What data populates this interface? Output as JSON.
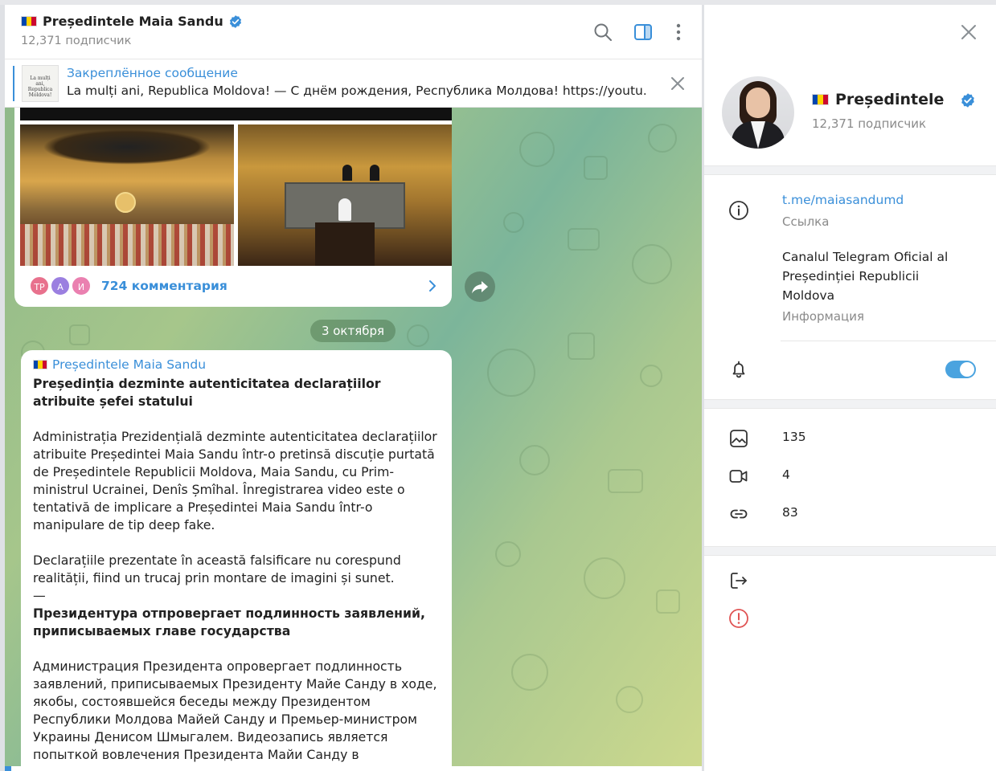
{
  "header": {
    "channel_name": "Președintele Maia Sandu",
    "subscribers": "12,371 подписчик",
    "icons": [
      "search-icon",
      "sidebar-toggle-icon",
      "more-vert-icon"
    ]
  },
  "pinned": {
    "title": "Закреплённое сообщение",
    "text": "La mulți ani, Republica Moldova! — С днём рождения, Республика Молдова!  https://youtu.b...",
    "thumb_text": "La mulți ani, Republica Moldova!"
  },
  "message1": {
    "avatars": [
      {
        "initials": "ТР",
        "color": "#e8718d"
      },
      {
        "initials": "А",
        "color": "#9b7fe0"
      },
      {
        "initials": "И",
        "color": "#ea80b0"
      }
    ],
    "comments": "724 комментария"
  },
  "date_separator": "3 октября",
  "message2": {
    "author": "Președintele Maia Sandu",
    "title_ro": "Președinția dezminte autenticitatea declarațiilor atribuite șefei statului",
    "para1_ro": "Administrația Prezidențială dezminte autenticitatea declarațiilor atribuite Președintei Maia Sandu într-o pretinsă discuție purtată de Președintele Republicii Moldova, Maia Sandu, cu Prim-ministrul Ucrainei, Denîs Șmîhal. Înregistrarea video este o tentativă de implicare a Președintei Maia Sandu într-o manipulare de tip deep fake.",
    "para2_ro": "Declarațiile prezentate în această falsificare nu corespund realității, fiind un trucaj prin montare de imagini și sunet.",
    "divider": "—",
    "title_ru": "Президентура отпровергает подлинность заявлений, приписываемых главе государства",
    "para1_ru": "Администрация Президента опровергает подлинность заявлений, приписываемых Президенту Майе Санду в ходе, якобы, состоявшейся беседы между Президентом Республики Молдова Майей Санду и Премьер-министром Украины Денисом Шмыгалем. Видеозапись является попыткой вовлечения Президента Майи Санду в манипуляцию типа deep"
  },
  "panel": {
    "name": "Președintele",
    "subscribers": "12,371 подписчик",
    "link": "t.me/maiasandumd",
    "link_label": "Ссылка",
    "description": "Canalul Telegram Oficial al Președinției Republicii Moldova",
    "description_label": "Информация",
    "notifications_on": true,
    "media": [
      {
        "icon": "photo-icon",
        "count": "135"
      },
      {
        "icon": "video-icon",
        "count": "4"
      },
      {
        "icon": "link-icon",
        "count": "83"
      }
    ],
    "actions": [
      "leave-channel-icon",
      "report-icon"
    ]
  },
  "colors": {
    "accent": "#3a8fd9",
    "toggle_on": "#4aa3df",
    "report": "#e05353"
  }
}
